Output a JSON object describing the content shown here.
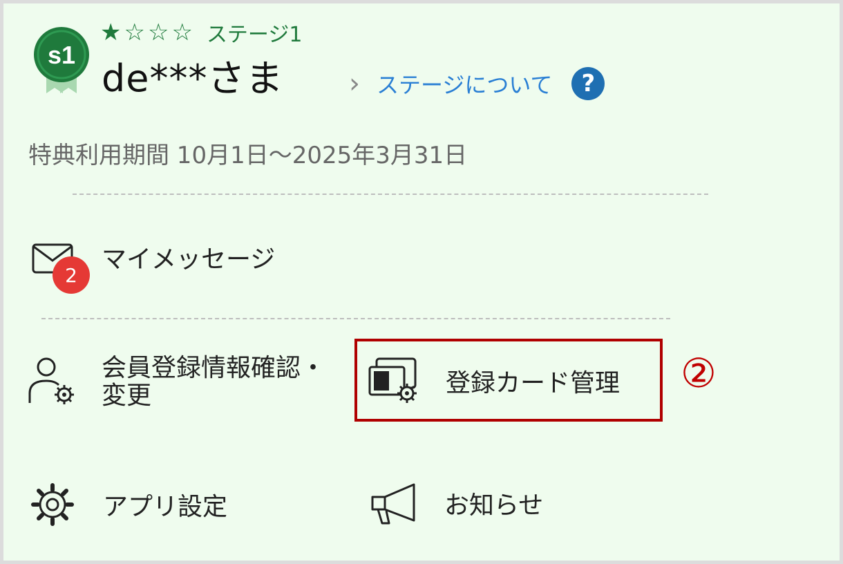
{
  "profile": {
    "badge_text": "s1",
    "stars_filled": 1,
    "stars_total": 4,
    "stage_label": "ステージ1",
    "username": "de***さま",
    "stage_link_label": "ステージについて",
    "help_symbol": "?",
    "benefit_period": "特典利用期間 10月1日〜2025年3月31日"
  },
  "menu": {
    "my_messages": {
      "label": "マイメッセージ",
      "badge_count": "2",
      "icon": "mail-icon"
    },
    "member_info": {
      "label_line1": "会員登録情報確認・",
      "label_line2": "変更",
      "icon": "user-settings-icon"
    },
    "card_management": {
      "label": "登録カード管理",
      "icon": "card-settings-icon"
    },
    "app_settings": {
      "label": "アプリ設定",
      "icon": "gear-icon"
    },
    "notices": {
      "label": "お知らせ",
      "icon": "megaphone-icon"
    }
  },
  "annotation": {
    "marker": "②"
  },
  "colors": {
    "background": "#effcee",
    "accent_green": "#1f7a3c",
    "link_blue": "#2a7fd4",
    "highlight_red": "#b00000",
    "badge_red": "#e53935"
  }
}
